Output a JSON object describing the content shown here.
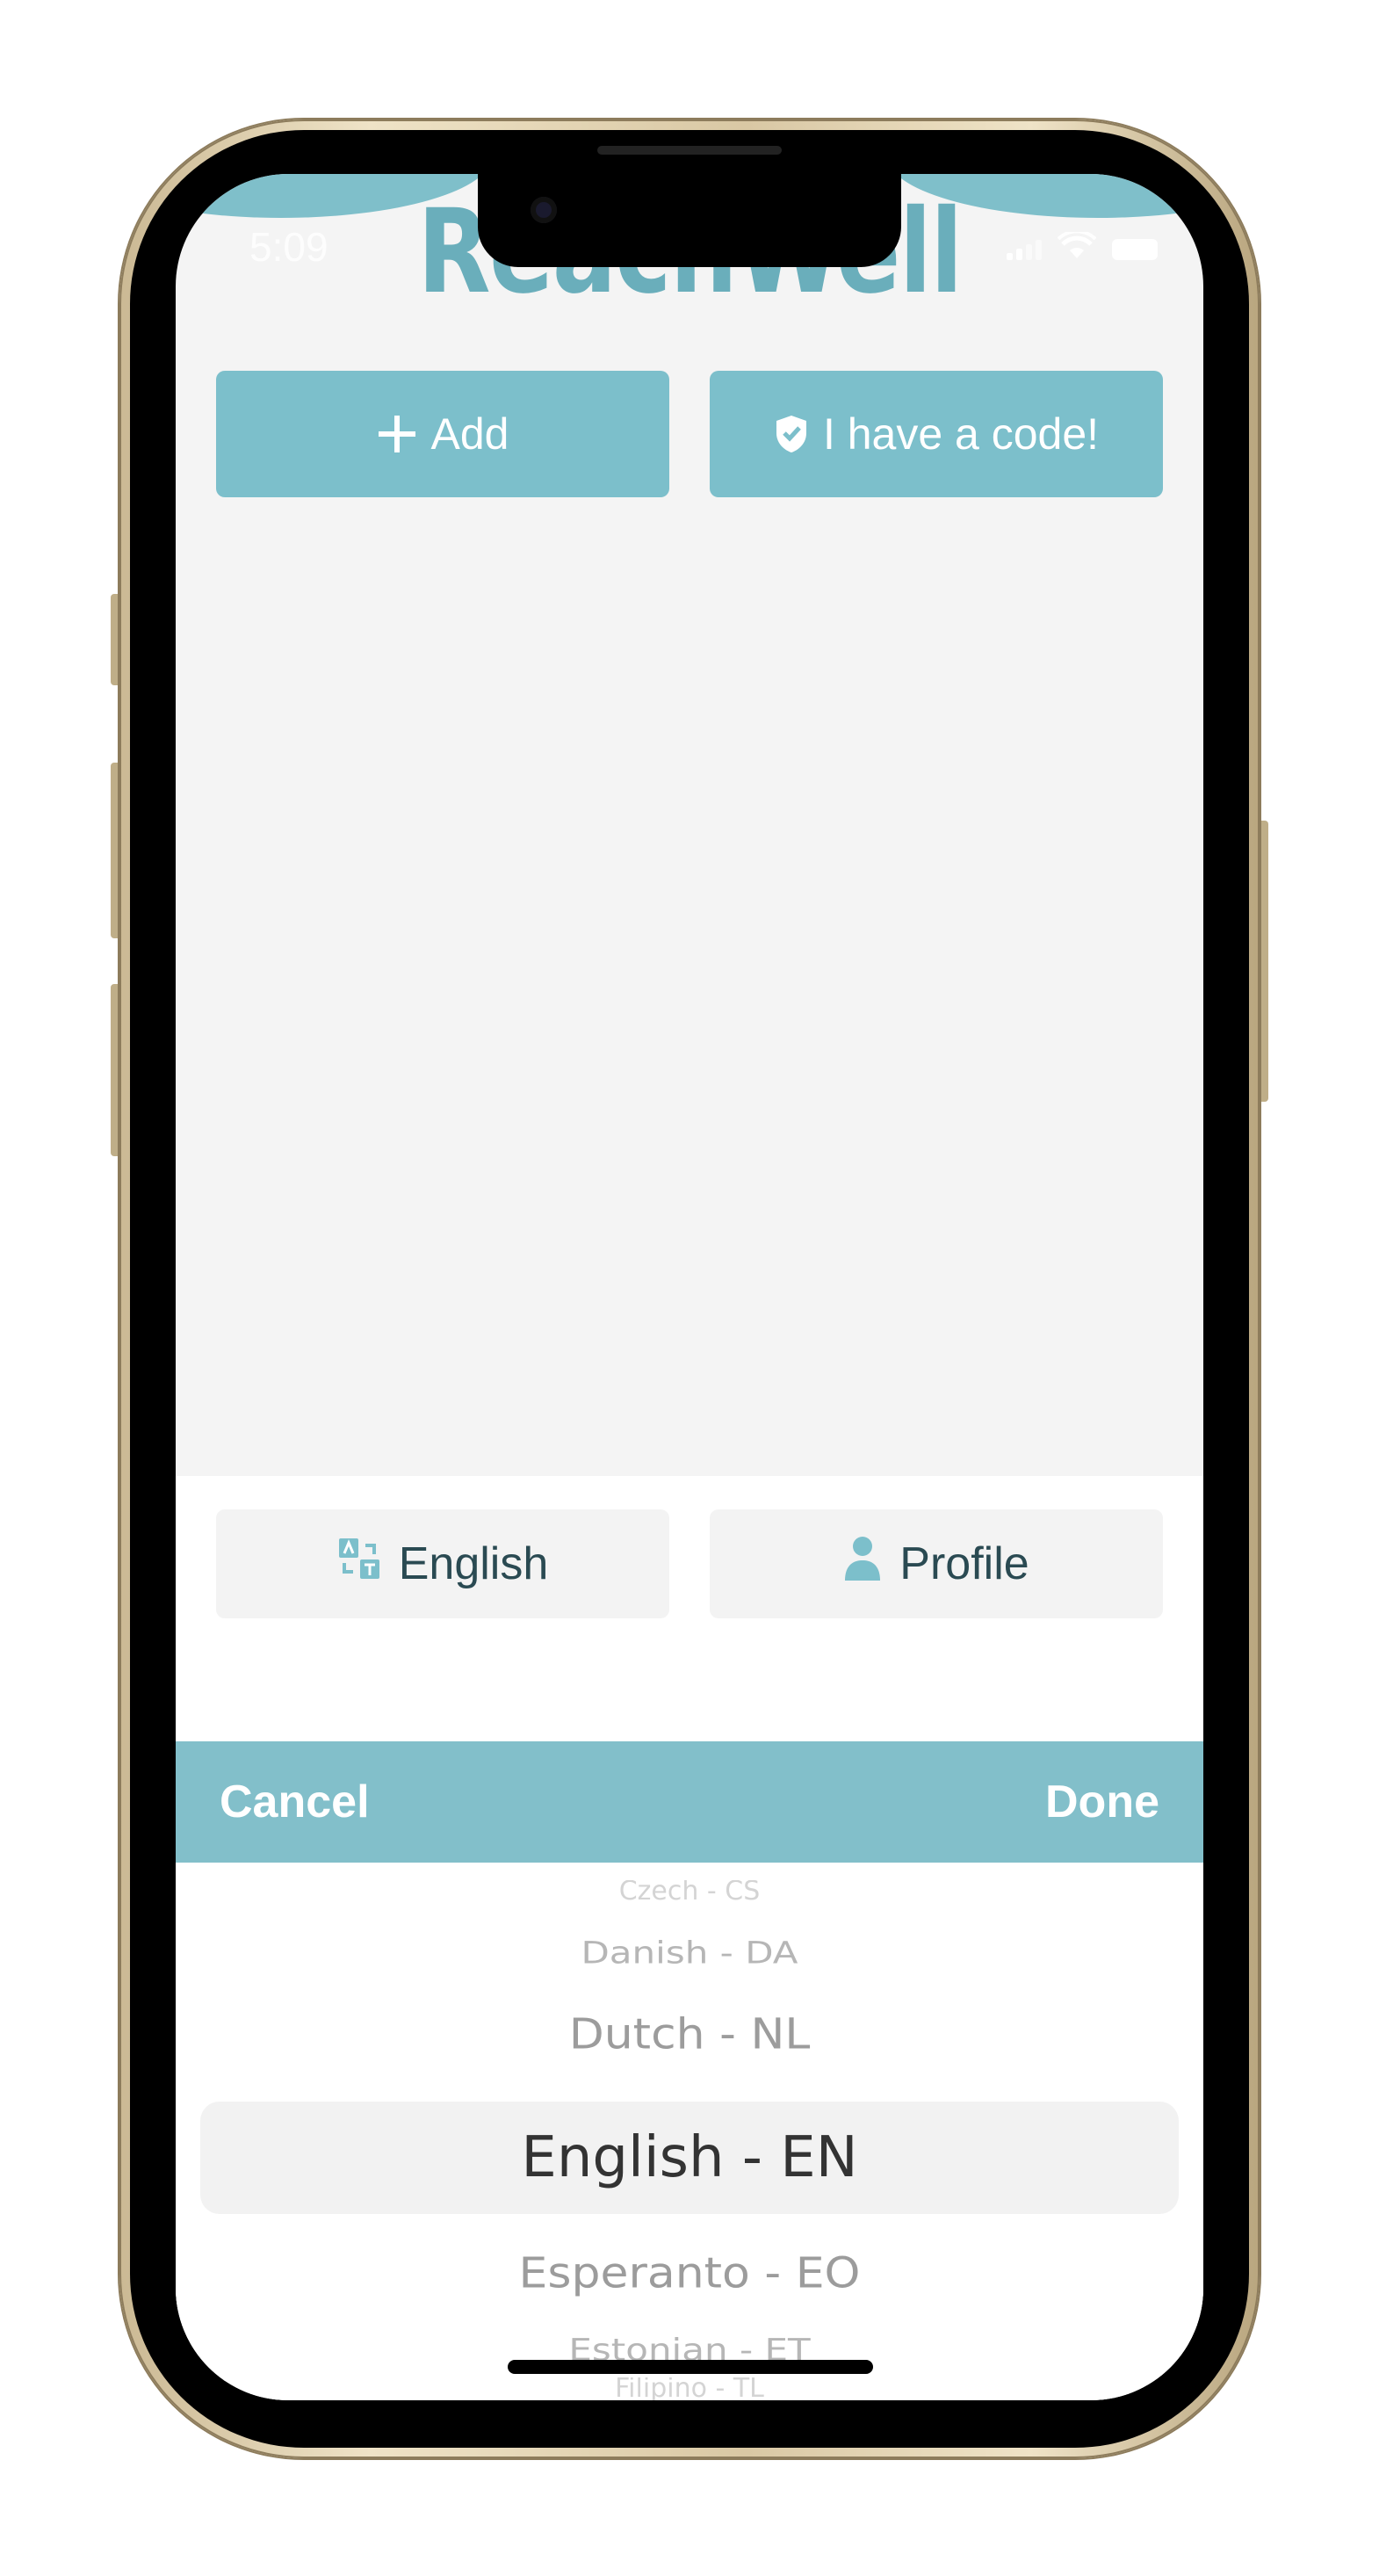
{
  "status_bar": {
    "time": "5:09"
  },
  "header": {
    "logo_text": "ReachWell"
  },
  "actions": {
    "add_label": "Add",
    "code_label": "I have a code!"
  },
  "footer_buttons": {
    "language_label": "English",
    "profile_label": "Profile"
  },
  "picker_toolbar": {
    "cancel_label": "Cancel",
    "done_label": "Done"
  },
  "language_picker": {
    "items": [
      "Czech - CS",
      "Danish - DA",
      "Dutch - NL",
      "English - EN",
      "Esperanto - EO",
      "Estonian - ET",
      "Filipino - TL"
    ],
    "selected": "English - EN"
  },
  "colors": {
    "accent": "#7cbfcb",
    "toolbar": "#82bfca",
    "logo": "#6aaebb",
    "button_text_dark": "#2a4a52"
  },
  "icons": {
    "add": "plus-icon",
    "code": "shield-check-icon",
    "language": "translate-icon",
    "profile": "person-icon"
  }
}
